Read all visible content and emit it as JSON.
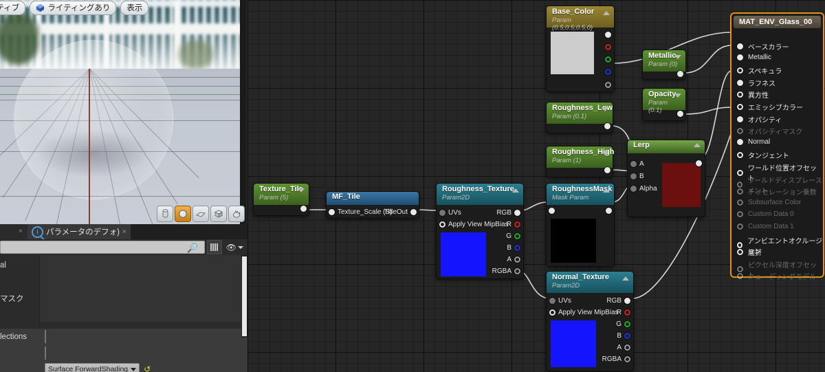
{
  "viewport": {
    "toolbar_buttons": [
      {
        "label": "クティブ",
        "icon": "none"
      },
      {
        "label": "ライティングあり",
        "icon": "cube-icon"
      },
      {
        "label": "表示",
        "icon": "none"
      }
    ],
    "mesh_buttons": [
      {
        "name": "cylinder",
        "glyph": "▯",
        "active": false
      },
      {
        "name": "sphere",
        "glyph": "●",
        "active": true
      },
      {
        "name": "plane",
        "glyph": "▰",
        "active": false
      },
      {
        "name": "cube",
        "glyph": "◼",
        "active": false
      },
      {
        "name": "teapot",
        "glyph": "◗",
        "active": false
      }
    ]
  },
  "details": {
    "tab_label": "パラメータのデフォ)",
    "search_value": "",
    "search_placeholder": "",
    "rows": [
      {
        "name": "al",
        "type": "text"
      },
      {
        "name": "マスク",
        "type": "text"
      },
      {
        "name": "lections",
        "type": "checkbox"
      },
      {
        "name": "",
        "type": "checkbox"
      },
      {
        "name": "",
        "type": "combo",
        "value": "Surface ForwardShading"
      }
    ]
  },
  "graph": {
    "nodes": [
      {
        "id": "base_color",
        "title": "Base_Color",
        "subtitle": "Param (0.5,0.5,0.5,0)",
        "header_color": "#8c7a2e",
        "swatch_color": "#cccccc",
        "arrow": "up",
        "outputs": [
          {
            "label": "",
            "pin": "white"
          },
          {
            "label": "",
            "pin": "r"
          },
          {
            "label": "",
            "pin": "g"
          },
          {
            "label": "",
            "pin": "b"
          },
          {
            "label": "",
            "pin": "gray"
          }
        ]
      },
      {
        "id": "metallic",
        "title": "Metallic",
        "subtitle": "Param (0)",
        "header_color": "#4e7a26",
        "arrow": "down",
        "outputs": [
          {
            "label": "",
            "pin": "white"
          }
        ]
      },
      {
        "id": "opacity",
        "title": "Opacity",
        "subtitle": "Param (0.1)",
        "header_color": "#4e7a26",
        "arrow": "down",
        "outputs": [
          {
            "label": "",
            "pin": "white"
          }
        ]
      },
      {
        "id": "roughness_low",
        "title": "Roughness_Low",
        "subtitle": "Param (0.1)",
        "header_color": "#4e7a26",
        "arrow": "down",
        "outputs": [
          {
            "label": "",
            "pin": "white"
          }
        ]
      },
      {
        "id": "roughness_high",
        "title": "Roughness_High",
        "subtitle": "Param (1)",
        "header_color": "#4e7a26",
        "arrow": "down",
        "outputs": [
          {
            "label": "",
            "pin": "white"
          }
        ]
      },
      {
        "id": "lerp",
        "title": "Lerp",
        "subtitle": "",
        "header_color": "#4e7a26",
        "arrow": "up",
        "swatch_color": "#6b0f0f",
        "inputs": [
          {
            "label": "A"
          },
          {
            "label": "B"
          },
          {
            "label": "Alpha"
          }
        ],
        "outputs": [
          {
            "label": "",
            "pin": "white"
          }
        ]
      },
      {
        "id": "texture_tile",
        "title": "Texture_Tile",
        "subtitle": "Param (5)",
        "header_color": "#4e7a26",
        "arrow": "down",
        "outputs": [
          {
            "label": "",
            "pin": "white"
          }
        ]
      },
      {
        "id": "mf_tile",
        "title": "MF_Tile",
        "subtitle": "",
        "header_color": "#2a5f86",
        "inputs": [
          {
            "label": "Texture_Scale (S)"
          }
        ],
        "outputs": [
          {
            "label": "TitleOut",
            "pin": "white"
          }
        ]
      },
      {
        "id": "roughness_texture",
        "title": "Roughness_Texture",
        "subtitle": "Param2D",
        "header_color": "#1f6a78",
        "arrow": "up",
        "swatch_color": "#1414ff",
        "inputs": [
          {
            "label": "UVs",
            "pin": "filled-gray"
          },
          {
            "label": "Apply View MipBias",
            "pin": "hollow-gray"
          }
        ],
        "outputs": [
          {
            "label": "RGB",
            "pin": "white"
          },
          {
            "label": "R",
            "pin": "r"
          },
          {
            "label": "G",
            "pin": "g"
          },
          {
            "label": "B",
            "pin": "b"
          },
          {
            "label": "A",
            "pin": "gray"
          },
          {
            "label": "RGBA",
            "pin": "gray"
          }
        ]
      },
      {
        "id": "roughness_mask",
        "title": "RoughnessMask",
        "subtitle": "Mask Param",
        "header_color": "#1f6a78",
        "arrow": "up",
        "swatch_color": "#000000",
        "inputs": [
          {
            "label": "",
            "pin": "white"
          }
        ],
        "outputs": [
          {
            "label": "",
            "pin": "white"
          }
        ]
      },
      {
        "id": "normal_texture",
        "title": "Normal_Texture",
        "subtitle": "Param2D",
        "header_color": "#1f6a78",
        "arrow": "up",
        "swatch_color": "#1414ff",
        "inputs": [
          {
            "label": "UVs",
            "pin": "filled-gray"
          },
          {
            "label": "Apply View MipBias",
            "pin": "hollow-gray"
          }
        ],
        "outputs": [
          {
            "label": "RGB",
            "pin": "white"
          },
          {
            "label": "R",
            "pin": "r"
          },
          {
            "label": "G",
            "pin": "g"
          },
          {
            "label": "B",
            "pin": "b"
          },
          {
            "label": "A",
            "pin": "gray"
          },
          {
            "label": "RGBA",
            "pin": "gray"
          }
        ]
      }
    ],
    "result_node": {
      "title": "MAT_ENV_Glass_00",
      "border_color": "#e8920f",
      "pins": [
        {
          "label": "ベースカラー",
          "connected": true,
          "enabled": true
        },
        {
          "label": "Metallic",
          "connected": true,
          "enabled": true
        },
        {
          "label": "スペキュラ",
          "connected": false,
          "enabled": true
        },
        {
          "label": "ラフネス",
          "connected": true,
          "enabled": true
        },
        {
          "label": "異方性",
          "connected": false,
          "enabled": true
        },
        {
          "label": "エミッシブカラー",
          "connected": false,
          "enabled": true
        },
        {
          "label": "オパシティ",
          "connected": true,
          "enabled": true
        },
        {
          "label": "オパシティマスク",
          "connected": false,
          "enabled": false
        },
        {
          "label": "Normal",
          "connected": true,
          "enabled": true
        },
        {
          "label": "タンジェント",
          "connected": false,
          "enabled": true
        },
        {
          "label": "ワールド位置オフセット",
          "connected": false,
          "enabled": true
        },
        {
          "label": "ワールドディスプレースメント",
          "connected": false,
          "enabled": false
        },
        {
          "label": "テッセレーション乗数",
          "connected": false,
          "enabled": false
        },
        {
          "label": "Subsurface Color",
          "connected": false,
          "enabled": false
        },
        {
          "label": "Custom Data 0",
          "connected": false,
          "enabled": false
        },
        {
          "label": "Custom Data 1",
          "connected": false,
          "enabled": false
        },
        {
          "label": "アンビエントオクルージョン",
          "connected": false,
          "enabled": true
        },
        {
          "label": "屈折",
          "connected": false,
          "enabled": true
        },
        {
          "label": "ピクセル深度オフセット",
          "connected": false,
          "enabled": false
        },
        {
          "label": "シェーディングモデル",
          "connected": false,
          "enabled": false
        }
      ]
    }
  }
}
